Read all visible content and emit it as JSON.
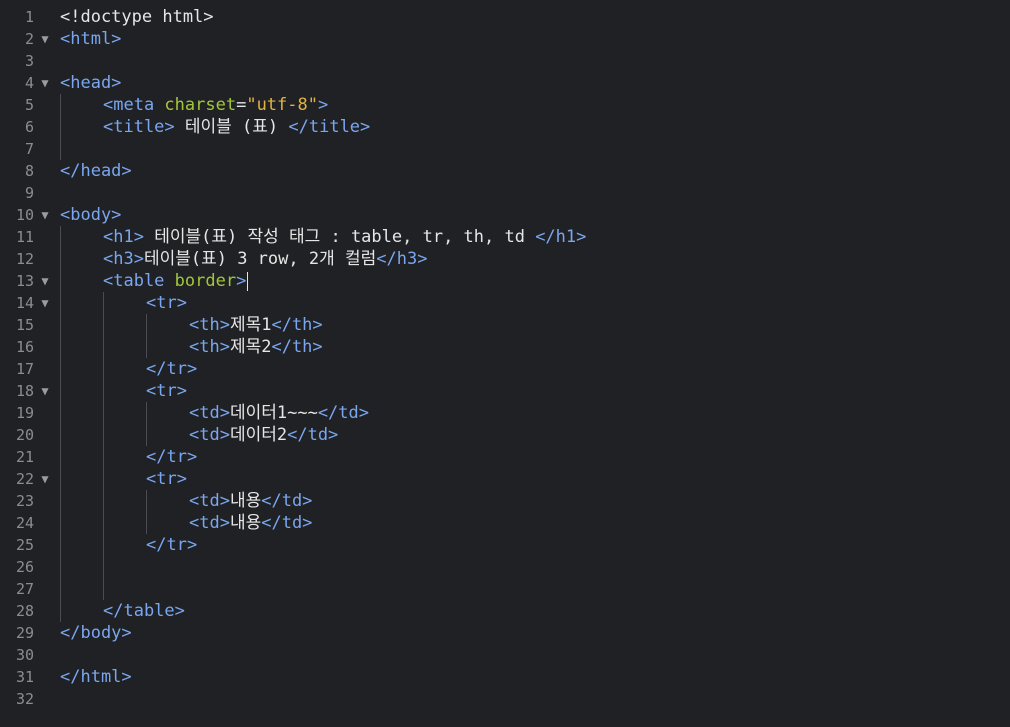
{
  "editor": {
    "lines": [
      {
        "num": "1",
        "fold": "",
        "indent": 0,
        "tokens": [
          {
            "t": "doctype",
            "v": "<!doctype html>"
          }
        ]
      },
      {
        "num": "2",
        "fold": "▼",
        "indent": 0,
        "tokens": [
          {
            "t": "tag",
            "v": "<html>"
          }
        ]
      },
      {
        "num": "3",
        "fold": "",
        "indent": 0,
        "tokens": []
      },
      {
        "num": "4",
        "fold": "▼",
        "indent": 0,
        "tokens": [
          {
            "t": "tag",
            "v": "<head>"
          }
        ]
      },
      {
        "num": "5",
        "fold": "",
        "indent": 1,
        "tokens": [
          {
            "t": "tag",
            "v": "<meta "
          },
          {
            "t": "attr",
            "v": "charset"
          },
          {
            "t": "punct",
            "v": "="
          },
          {
            "t": "str",
            "v": "\"utf-8\""
          },
          {
            "t": "tag",
            "v": ">"
          }
        ]
      },
      {
        "num": "6",
        "fold": "",
        "indent": 1,
        "tokens": [
          {
            "t": "tag",
            "v": "<title>"
          },
          {
            "t": "text",
            "v": " 테이블 (표) "
          },
          {
            "t": "tag",
            "v": "</title>"
          }
        ]
      },
      {
        "num": "7",
        "fold": "",
        "indent": 0,
        "tokens": []
      },
      {
        "num": "8",
        "fold": "",
        "indent": 0,
        "tokens": [
          {
            "t": "tag",
            "v": "</head>"
          }
        ]
      },
      {
        "num": "9",
        "fold": "",
        "indent": 0,
        "tokens": []
      },
      {
        "num": "10",
        "fold": "▼",
        "indent": 0,
        "tokens": [
          {
            "t": "tag",
            "v": "<body>"
          }
        ]
      },
      {
        "num": "11",
        "fold": "",
        "indent": 1,
        "tokens": [
          {
            "t": "tag",
            "v": "<h1>"
          },
          {
            "t": "text",
            "v": " 테이블(표) 작성 태그 : table, tr, th, td "
          },
          {
            "t": "tag",
            "v": "</h1>"
          }
        ]
      },
      {
        "num": "12",
        "fold": "",
        "indent": 1,
        "tokens": [
          {
            "t": "tag",
            "v": "<h3>"
          },
          {
            "t": "text",
            "v": "테이블(표) 3 row, 2개 컬럼"
          },
          {
            "t": "tag",
            "v": "</h3>"
          }
        ]
      },
      {
        "num": "13",
        "fold": "▼",
        "indent": 1,
        "tokens": [
          {
            "t": "tag",
            "v": "<table "
          },
          {
            "t": "attr",
            "v": "border"
          },
          {
            "t": "tag",
            "v": ">"
          }
        ]
      },
      {
        "num": "14",
        "fold": "▼",
        "indent": 2,
        "tokens": [
          {
            "t": "tag",
            "v": "<tr>"
          }
        ]
      },
      {
        "num": "15",
        "fold": "",
        "indent": 3,
        "tokens": [
          {
            "t": "tag",
            "v": "<th>"
          },
          {
            "t": "text",
            "v": "제목1"
          },
          {
            "t": "tag",
            "v": "</th>"
          }
        ]
      },
      {
        "num": "16",
        "fold": "",
        "indent": 3,
        "tokens": [
          {
            "t": "tag",
            "v": "<th>"
          },
          {
            "t": "text",
            "v": "제목2"
          },
          {
            "t": "tag",
            "v": "</th>"
          }
        ]
      },
      {
        "num": "17",
        "fold": "",
        "indent": 2,
        "tokens": [
          {
            "t": "tag",
            "v": "</tr>"
          }
        ]
      },
      {
        "num": "18",
        "fold": "▼",
        "indent": 2,
        "tokens": [
          {
            "t": "tag",
            "v": "<tr>"
          }
        ]
      },
      {
        "num": "19",
        "fold": "",
        "indent": 3,
        "tokens": [
          {
            "t": "tag",
            "v": "<td>"
          },
          {
            "t": "text",
            "v": "데이터1~~~"
          },
          {
            "t": "tag",
            "v": "</td>"
          }
        ]
      },
      {
        "num": "20",
        "fold": "",
        "indent": 3,
        "tokens": [
          {
            "t": "tag",
            "v": "<td>"
          },
          {
            "t": "text",
            "v": "데이터2"
          },
          {
            "t": "tag",
            "v": "</td>"
          }
        ]
      },
      {
        "num": "21",
        "fold": "",
        "indent": 2,
        "tokens": [
          {
            "t": "tag",
            "v": "</tr>"
          }
        ]
      },
      {
        "num": "22",
        "fold": "▼",
        "indent": 2,
        "tokens": [
          {
            "t": "tag",
            "v": "<tr>"
          }
        ]
      },
      {
        "num": "23",
        "fold": "",
        "indent": 3,
        "tokens": [
          {
            "t": "tag",
            "v": "<td>"
          },
          {
            "t": "text",
            "v": "내용"
          },
          {
            "t": "tag",
            "v": "</td>"
          }
        ]
      },
      {
        "num": "24",
        "fold": "",
        "indent": 3,
        "tokens": [
          {
            "t": "tag",
            "v": "<td>"
          },
          {
            "t": "text",
            "v": "내용"
          },
          {
            "t": "tag",
            "v": "</td>"
          }
        ]
      },
      {
        "num": "25",
        "fold": "",
        "indent": 2,
        "tokens": [
          {
            "t": "tag",
            "v": "</tr>"
          }
        ]
      },
      {
        "num": "26",
        "fold": "",
        "indent": 0,
        "tokens": []
      },
      {
        "num": "27",
        "fold": "",
        "indent": 0,
        "tokens": []
      },
      {
        "num": "28",
        "fold": "",
        "indent": 1,
        "tokens": [
          {
            "t": "tag",
            "v": "</table>"
          }
        ]
      },
      {
        "num": "29",
        "fold": "",
        "indent": 0,
        "tokens": [
          {
            "t": "tag",
            "v": "</body>"
          }
        ]
      },
      {
        "num": "30",
        "fold": "",
        "indent": 0,
        "tokens": []
      },
      {
        "num": "31",
        "fold": "",
        "indent": 0,
        "tokens": [
          {
            "t": "tag",
            "v": "</html>"
          }
        ]
      },
      {
        "num": "32",
        "fold": "",
        "indent": 0,
        "tokens": []
      }
    ],
    "cursor_line": 13,
    "colors": {
      "background": "#1f2124",
      "tag": "#7aa6f0",
      "attribute": "#a3c63a",
      "string": "#e2b340",
      "text": "#e6e6e6",
      "line_number": "#8b8d90"
    },
    "icons": {
      "fold": "fold-arrow-icon"
    }
  }
}
